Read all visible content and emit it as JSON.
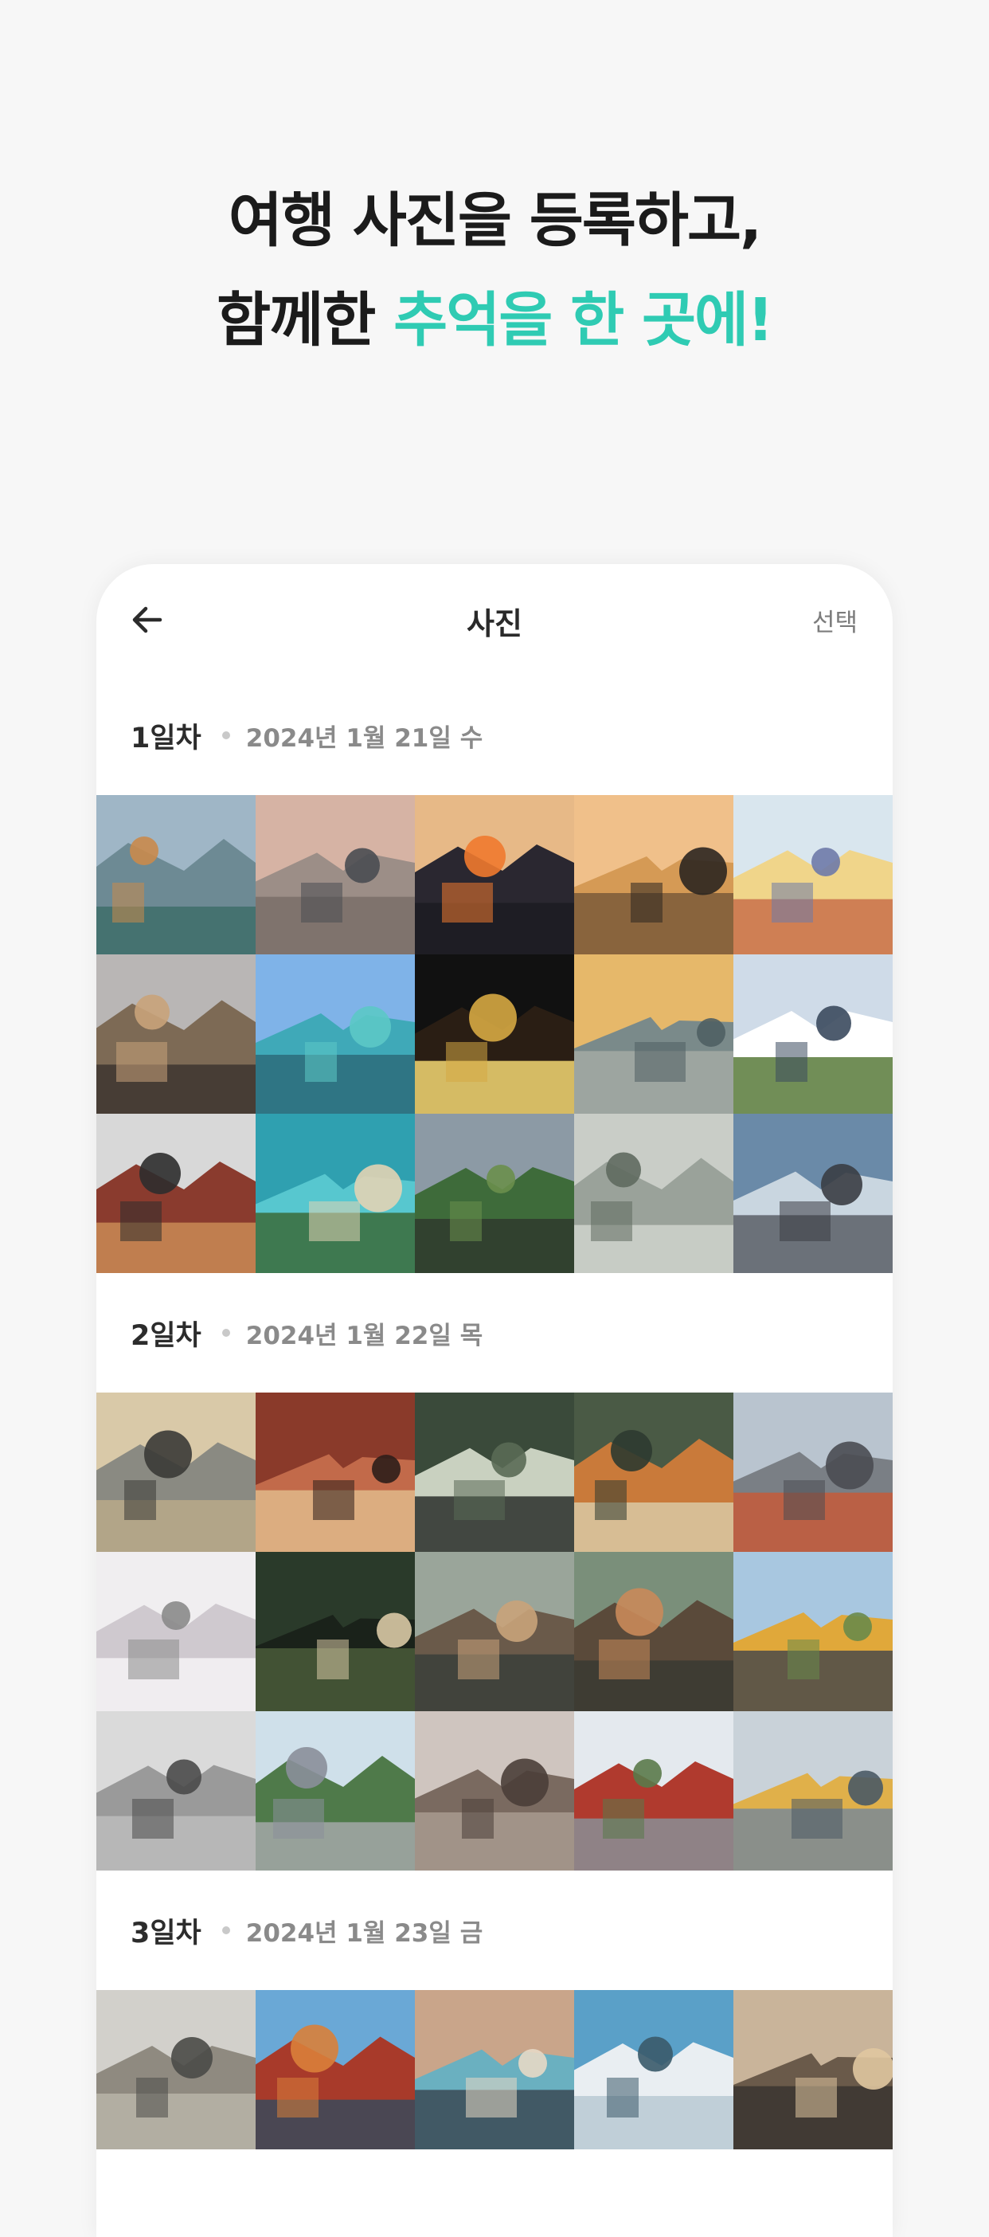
{
  "hero": {
    "line1": "여행 사진을 등록하고,",
    "line2_prefix": "함께한 ",
    "line2_accent": "추억을 한 곳에!"
  },
  "app": {
    "title": "사진",
    "select_label": "선택",
    "back_icon": "arrow-left-icon"
  },
  "days": [
    {
      "label": "1일차",
      "date": "2024년 1월 21일 수",
      "photos": [
        {
          "name": "mountain-lake-boat"
        },
        {
          "name": "person-on-rocks"
        },
        {
          "name": "airplane-wing-sunset"
        },
        {
          "name": "friends-silhouette-sunset"
        },
        {
          "name": "friends-group-ferris-wheel"
        },
        {
          "name": "palace-beach"
        },
        {
          "name": "tropical-water-bungalows"
        },
        {
          "name": "glowing-moon-hand"
        },
        {
          "name": "big-ben-river"
        },
        {
          "name": "japanese-castle"
        },
        {
          "name": "photographer-camera"
        },
        {
          "name": "turquoise-beach-cliff"
        },
        {
          "name": "green-mountains-hiker"
        },
        {
          "name": "misty-bridge-path"
        },
        {
          "name": "japanese-street"
        }
      ]
    },
    {
      "label": "2일차",
      "date": "2024년 1월 22일 목",
      "photos": [
        {
          "name": "corner-building"
        },
        {
          "name": "red-shop-front"
        },
        {
          "name": "narrow-alley"
        },
        {
          "name": "street-shops"
        },
        {
          "name": "city-crossing"
        },
        {
          "name": "cherry-blossom"
        },
        {
          "name": "kimono-night-street"
        },
        {
          "name": "wooden-houses"
        },
        {
          "name": "wooden-houses-2"
        },
        {
          "name": "autumn-trees-street"
        },
        {
          "name": "bw-city-street"
        },
        {
          "name": "green-mountain-town"
        },
        {
          "name": "old-alley-buildings"
        },
        {
          "name": "pagoda-mountain"
        },
        {
          "name": "canal-city-signs"
        }
      ]
    },
    {
      "label": "3일차",
      "date": "2024년 1월 23일 금",
      "photos": [
        {
          "name": "graffiti-street"
        },
        {
          "name": "red-pagoda-sky"
        },
        {
          "name": "sign-wall"
        },
        {
          "name": "blue-stairs"
        },
        {
          "name": "evening-alley"
        }
      ]
    }
  ],
  "colors": {
    "accent": "#2fcbb3",
    "background": "#f7f7f7"
  }
}
